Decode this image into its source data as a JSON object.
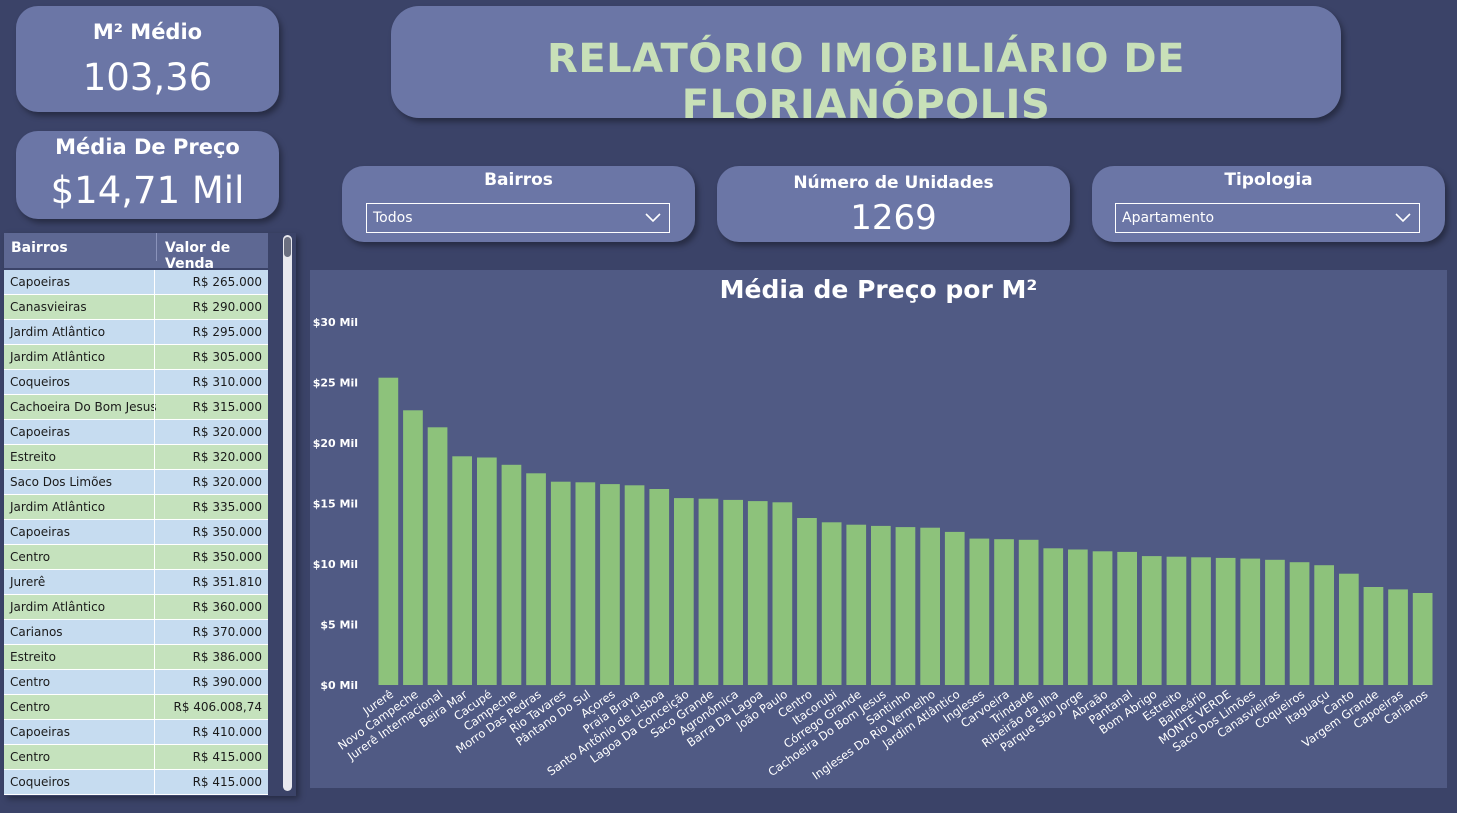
{
  "kpis": {
    "m2": {
      "title": "M² Médio",
      "value": "103,36"
    },
    "price": {
      "title": "Média De Preço",
      "value": "$14,71 Mil"
    },
    "units": {
      "title": "Número de Unidades",
      "value": "1269"
    }
  },
  "report_title": "RELATÓRIO IMOBILIÁRIO DE FLORIANÓPOLIS",
  "filters": {
    "bairros": {
      "title": "Bairros",
      "selected": "Todos"
    },
    "tipologia": {
      "title": "Tipologia",
      "selected": "Apartamento"
    }
  },
  "icons": {
    "dropdown": "chevron-down-icon"
  },
  "colors": {
    "background": "#3b4368",
    "card": "#6b76a6",
    "bar": "#8dc27b",
    "title_accent": "#c8e0b8",
    "row_blue": "#c6dcf0",
    "row_green": "#c5e2bd"
  },
  "table": {
    "headers": [
      "Bairros",
      "Valor de Venda"
    ],
    "rows": [
      [
        "Capoeiras",
        "R$ 265.000"
      ],
      [
        "Canasvieiras",
        "R$ 290.000"
      ],
      [
        "Jardim Atlântico",
        "R$ 295.000"
      ],
      [
        "Jardim Atlântico",
        "R$ 305.000"
      ],
      [
        "Coqueiros",
        "R$ 310.000"
      ],
      [
        "Cachoeira Do Bom Jesus",
        "R$ 315.000"
      ],
      [
        "Capoeiras",
        "R$ 320.000"
      ],
      [
        "Estreito",
        "R$ 320.000"
      ],
      [
        "Saco Dos Limões",
        "R$ 320.000"
      ],
      [
        "Jardim Atlântico",
        "R$ 335.000"
      ],
      [
        "Capoeiras",
        "R$ 350.000"
      ],
      [
        "Centro",
        "R$ 350.000"
      ],
      [
        "Jurerê",
        "R$ 351.810"
      ],
      [
        "Jardim Atlântico",
        "R$ 360.000"
      ],
      [
        "Carianos",
        "R$ 370.000"
      ],
      [
        "Estreito",
        "R$ 386.000"
      ],
      [
        "Centro",
        "R$ 390.000"
      ],
      [
        "Centro",
        "R$ 406.008,74"
      ],
      [
        "Capoeiras",
        "R$ 410.000"
      ],
      [
        "Centro",
        "R$ 415.000"
      ],
      [
        "Coqueiros",
        "R$ 415.000"
      ]
    ]
  },
  "chart_data": {
    "type": "bar",
    "title": "Média de Preço por M²",
    "xlabel": "",
    "ylabel": "",
    "ylim": [
      0,
      30000
    ],
    "yticks": [
      0,
      5000,
      10000,
      15000,
      20000,
      25000,
      30000
    ],
    "ytick_labels": [
      "$0 Mil",
      "$5 Mil",
      "$10 Mil",
      "$15 Mil",
      "$20 Mil",
      "$25 Mil",
      "$30 Mil"
    ],
    "grid": false,
    "categories": [
      "Jurerê",
      "Novo Campeche",
      "Jurerê Internacional",
      "Beira Mar",
      "Cacupé",
      "Campeche",
      "Morro Das Pedras",
      "Rio Tavares",
      "Pântano Do Sul",
      "Açores",
      "Praia Brava",
      "Santo Antônio de Lisboa",
      "Lagoa Da Conceição",
      "Saco Grande",
      "Agronômica",
      "Barra Da Lagoa",
      "João Paulo",
      "Centro",
      "Itacorubi",
      "Córrego Grande",
      "Cachoeira Do Bom Jesus",
      "Santinho",
      "Ingleses Do Rio Vermelho",
      "Jardim Atlântico",
      "Ingleses",
      "Carvoeira",
      "Trindade",
      "Ribeirão da Ilha",
      "Parque São Jorge",
      "Abraão",
      "Pantanal",
      "Bom Abrigo",
      "Estreito",
      "Balneário",
      "MONTE VERDE",
      "Saco Dos Limões",
      "Canasvieiras",
      "Coqueiros",
      "Itaguaçu",
      "Canto",
      "Vargem Grande",
      "Capoeiras",
      "Carianos"
    ],
    "values": [
      25400,
      22700,
      21300,
      18900,
      18800,
      18200,
      17500,
      16800,
      16750,
      16600,
      16500,
      16200,
      15450,
      15400,
      15300,
      15200,
      15100,
      13800,
      13450,
      13250,
      13150,
      13050,
      13000,
      12650,
      12100,
      12050,
      12000,
      11300,
      11200,
      11050,
      11000,
      10650,
      10600,
      10550,
      10500,
      10450,
      10350,
      10150,
      9900,
      9200,
      8100,
      7900,
      7600
    ]
  }
}
